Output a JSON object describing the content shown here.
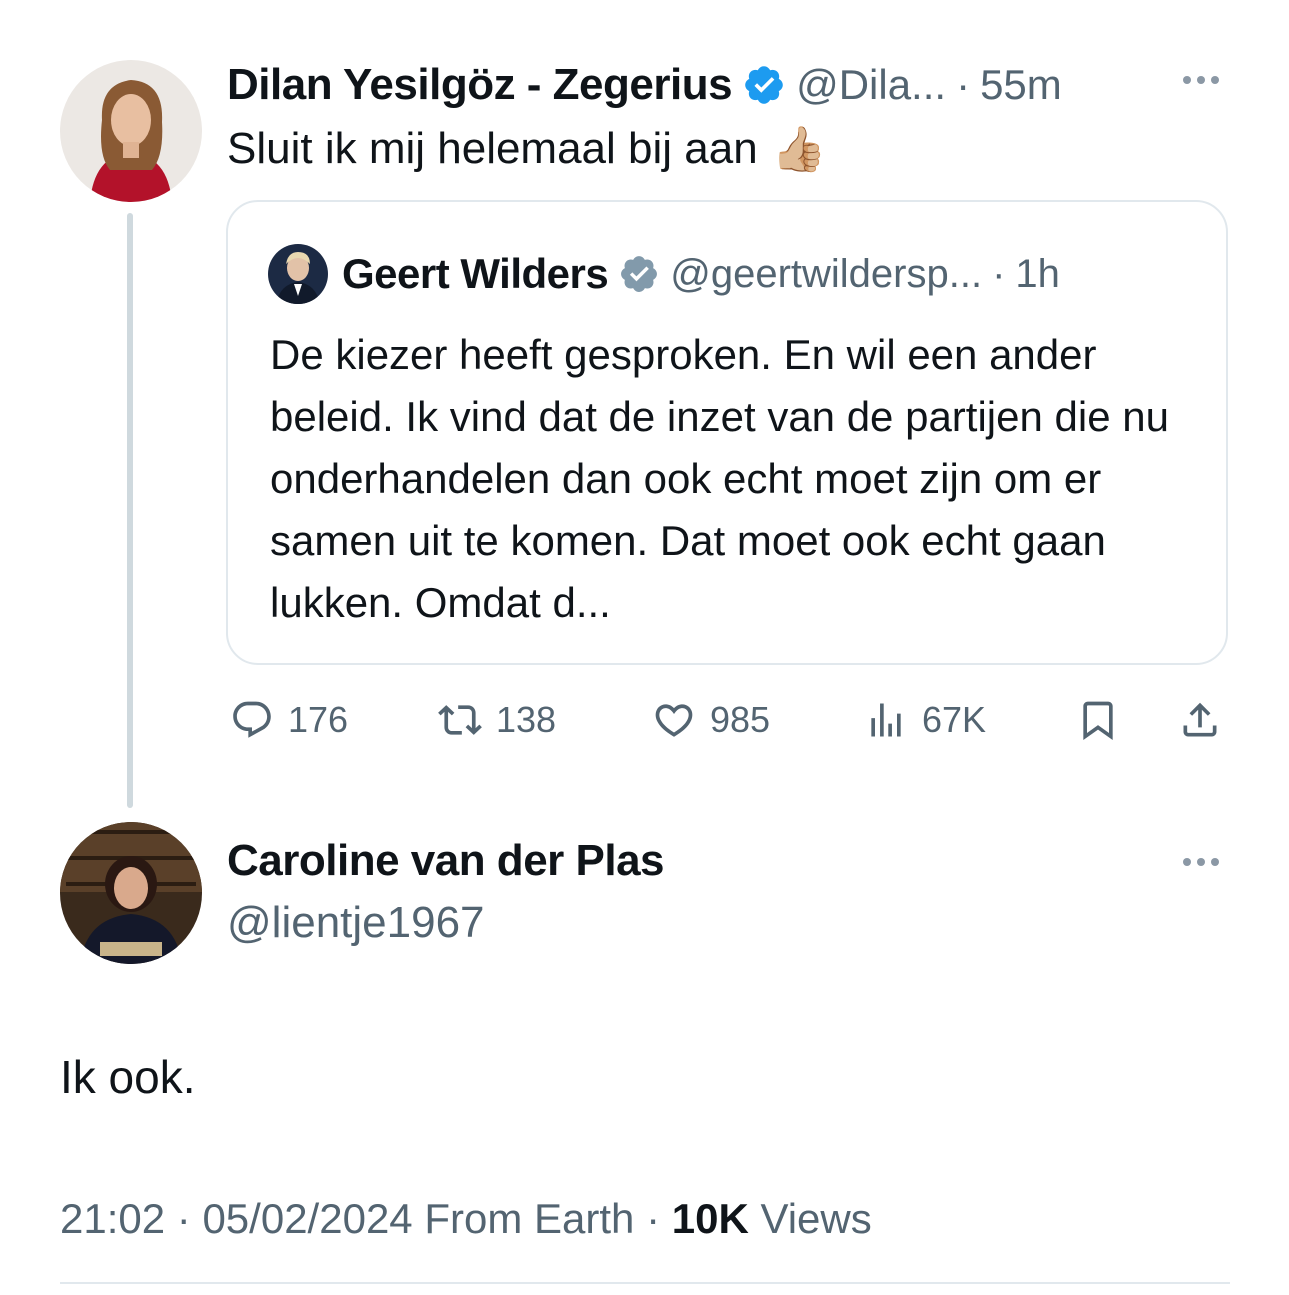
{
  "tweet1": {
    "name": "Dilan Yesilgöz - Zegerius",
    "handle": "@Dila...",
    "time": "55m",
    "separator": "·",
    "text": "Sluit ik mij helemaal bij aan",
    "emoji": "👍🏼",
    "verified_color": "#1d9bf0"
  },
  "quote": {
    "name": "Geert Wilders",
    "handle": "@geertwildersp...",
    "time": "1h",
    "separator": "·",
    "text": "De kiezer heeft gesproken. En wil een ander beleid. Ik vind dat de inzet van de partijen die nu onderhandelen dan ook echt moet zijn om er samen uit te komen. Dat moet ook echt gaan lukken. Omdat d...",
    "verified_color": "#829aab"
  },
  "actions": {
    "replies": "176",
    "retweets": "138",
    "likes": "985",
    "views": "67K"
  },
  "tweet2": {
    "name": "Caroline van der Plas",
    "handle": "@lientje1967",
    "text": "Ik ook.",
    "time": "21:02",
    "date": "05/02/2024",
    "source": "From Earth",
    "separator": "·",
    "views_count": "10K",
    "views_label": "Views"
  },
  "colors": {
    "text": "#0f1419",
    "muted": "#536471",
    "border": "#e1e8ed",
    "accent": "#1d9bf0"
  }
}
